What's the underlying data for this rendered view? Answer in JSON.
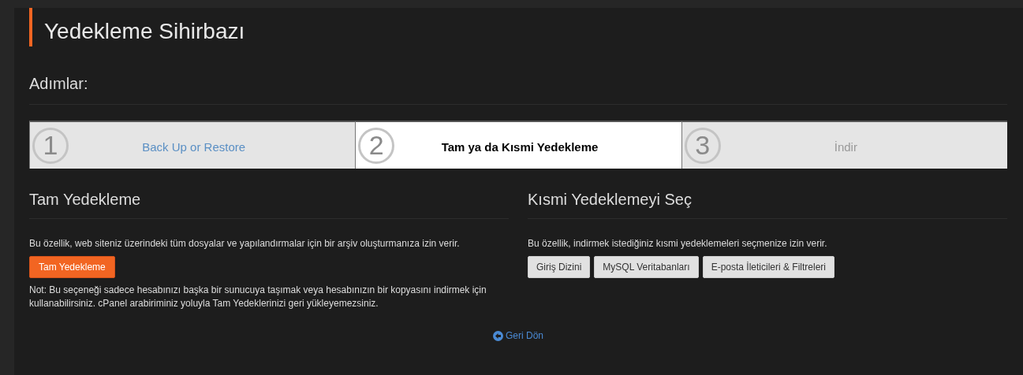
{
  "page": {
    "title": "Yedekleme Sihirbazı",
    "steps_heading": "Adımlar:"
  },
  "steps": [
    {
      "number": "1",
      "label": "Back Up or Restore",
      "selected": false,
      "kind": "link"
    },
    {
      "number": "2",
      "label": "Tam ya da Kısmi Yedekleme",
      "selected": true,
      "kind": "current"
    },
    {
      "number": "3",
      "label": "İndir",
      "selected": false,
      "kind": "pending"
    }
  ],
  "full_backup": {
    "heading": "Tam Yedekleme",
    "description": "Bu özellik, web siteniz üzerindeki tüm dosyalar ve yapılandırmalar için bir arşiv oluşturmanıza izin verir.",
    "button": "Tam Yedekleme",
    "note": "Not: Bu seçeneği sadece hesabınızı başka bir sunucuya taşımak veya hesabınızın bir kopyasını indirmek için kullanabilirsiniz. cPanel arabiriminiz yoluyla Tam Yedeklerinizi geri yükleyemezsiniz."
  },
  "partial_backup": {
    "heading": "Kısmi Yedeklemeyi Seç",
    "description": "Bu özellik, indirmek istediğiniz kısmi yedeklemeleri seçmenize izin verir.",
    "buttons": [
      "Giriş Dizini",
      "MySQL Veritabanları",
      "E-posta İleticileri & Filtreleri"
    ]
  },
  "back_link": "Geri Dön"
}
